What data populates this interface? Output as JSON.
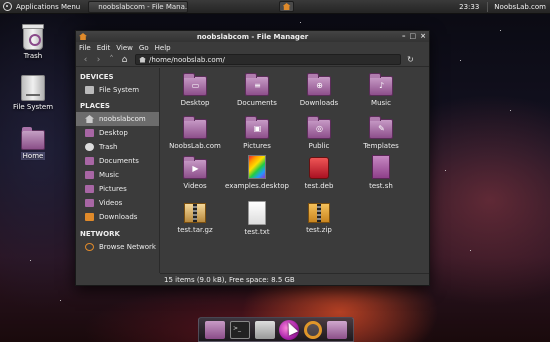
{
  "top_panel": {
    "apps_menu_label": "Applications Menu",
    "task_label": "noobslabcom - File Mana...",
    "clock": "23:33",
    "user": "NoobsLab.com"
  },
  "desktop_icons": [
    {
      "label": "Trash",
      "icon": "trash-icon"
    },
    {
      "label": "File System",
      "icon": "drive-icon"
    },
    {
      "label": "Home",
      "icon": "home-folder-icon"
    }
  ],
  "window": {
    "title": "noobslabcom - File Manager",
    "menu": [
      "File",
      "Edit",
      "View",
      "Go",
      "Help"
    ],
    "location": "/home/noobslab.com/",
    "status": "15 items (9.0 kB), Free space: 8.5 GB"
  },
  "sidebar": {
    "devices_heading": "DEVICES",
    "devices": [
      {
        "label": "File System",
        "icon": "drive-icon"
      }
    ],
    "places_heading": "PLACES",
    "places": [
      {
        "label": "noobslabcom",
        "icon": "home-icon",
        "active": true
      },
      {
        "label": "Desktop",
        "icon": "desktop-folder-icon"
      },
      {
        "label": "Trash",
        "icon": "trash-icon"
      },
      {
        "label": "Documents",
        "icon": "documents-folder-icon"
      },
      {
        "label": "Music",
        "icon": "music-folder-icon"
      },
      {
        "label": "Pictures",
        "icon": "pictures-folder-icon"
      },
      {
        "label": "Videos",
        "icon": "videos-folder-icon"
      },
      {
        "label": "Downloads",
        "icon": "downloads-folder-icon"
      }
    ],
    "network_heading": "NETWORK",
    "network": [
      {
        "label": "Browse Network",
        "icon": "network-icon"
      }
    ]
  },
  "files": [
    {
      "label": "Desktop",
      "type": "folder"
    },
    {
      "label": "Documents",
      "type": "folder"
    },
    {
      "label": "Downloads",
      "type": "folder"
    },
    {
      "label": "Music",
      "type": "folder"
    },
    {
      "label": "NoobsLab.com",
      "type": "folder"
    },
    {
      "label": "Pictures",
      "type": "folder"
    },
    {
      "label": "Public",
      "type": "folder"
    },
    {
      "label": "Templates",
      "type": "folder"
    },
    {
      "label": "Videos",
      "type": "folder"
    },
    {
      "label": "examples.desktop",
      "type": "desktop-file"
    },
    {
      "label": "test.deb",
      "type": "deb"
    },
    {
      "label": "test.sh",
      "type": "script"
    },
    {
      "label": "test.tar.gz",
      "type": "archive"
    },
    {
      "label": "test.txt",
      "type": "text"
    },
    {
      "label": "test.zip",
      "type": "archive"
    }
  ],
  "dock": [
    "folder-icon",
    "terminal-icon",
    "files-icon",
    "browser-icon",
    "search-icon",
    "folder-icon"
  ],
  "colors": {
    "accent": "#e08a2a",
    "folder": "#8d4f8b",
    "selection": "#6c6c6c"
  }
}
